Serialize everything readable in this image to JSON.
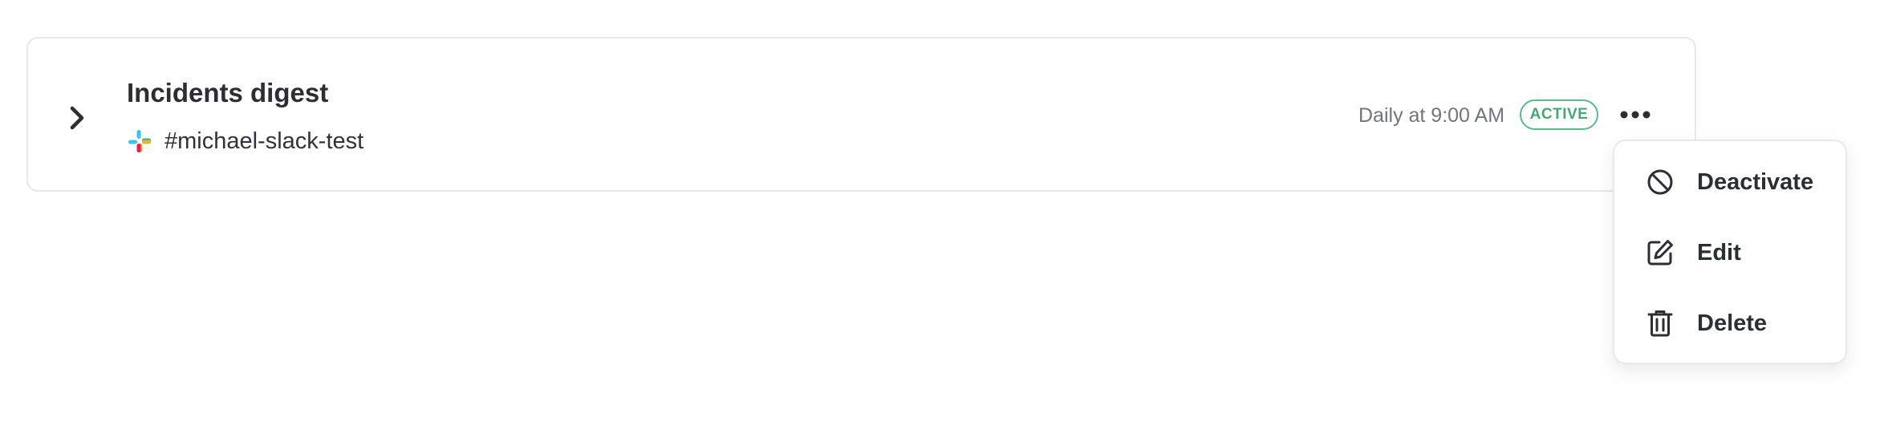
{
  "digest": {
    "title": "Incidents digest",
    "channel": "#michael-slack-test",
    "schedule": "Daily at 9:00 AM",
    "status": "ACTIVE"
  },
  "icons": {
    "expand": "chevron-right-icon",
    "channel": "slack-icon",
    "more": "more-horizontal-icon"
  },
  "menu": {
    "items": [
      {
        "label": "Deactivate",
        "icon": "ban-icon"
      },
      {
        "label": "Edit",
        "icon": "edit-icon"
      },
      {
        "label": "Delete",
        "icon": "trash-icon"
      }
    ]
  },
  "colors": {
    "active_badge": "#45a777",
    "text_primary": "#2b2e35",
    "text_muted": "#70757d",
    "border": "#e6e7ea"
  }
}
